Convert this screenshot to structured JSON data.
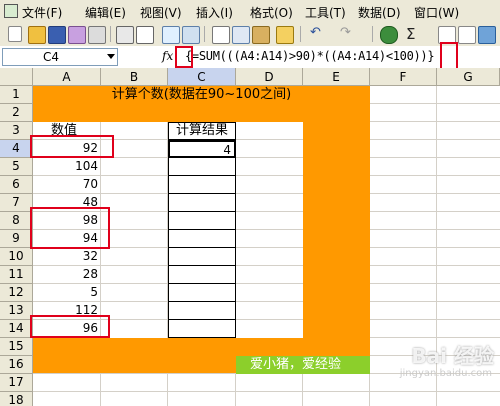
{
  "menu": {
    "items": [
      {
        "label": "文件(F)"
      },
      {
        "label": "编辑(E)"
      },
      {
        "label": "视图(V)"
      },
      {
        "label": "插入(I)"
      },
      {
        "label": "格式(O)"
      },
      {
        "label": "工具(T)"
      },
      {
        "label": "数据(D)"
      },
      {
        "label": "窗口(W)"
      }
    ]
  },
  "toolbar": {
    "undo_glyph": "↶",
    "redo_glyph": "↷",
    "sum_glyph": "Σ"
  },
  "formula_bar": {
    "name_box": "C4",
    "fx": "fx",
    "formula": "{=SUM(((A4:A14)>90)*((A4:A14)<100))}"
  },
  "columns": [
    "A",
    "B",
    "C",
    "D",
    "E",
    "F",
    "G"
  ],
  "rows": [
    "1",
    "2",
    "3",
    "4",
    "5",
    "6",
    "7",
    "8",
    "9",
    "10",
    "11",
    "12",
    "13",
    "14",
    "15",
    "16",
    "17",
    "18",
    "19"
  ],
  "sheet": {
    "title": "计算个数(数据在90~100之间)",
    "values_header": "数值",
    "result_header": "计算结果",
    "values": [
      "92",
      "104",
      "70",
      "48",
      "98",
      "94",
      "32",
      "28",
      "5",
      "112",
      "96"
    ],
    "result": "4",
    "banner_text": "爱小猪，爱经验"
  },
  "colors": {
    "orange_fill": "#ff9900",
    "highlight_red": "#e0001b",
    "banner_green": "#8ccf2b"
  },
  "watermark": {
    "brand": "Bai 经验",
    "url": "jingyan.baidu.com"
  }
}
